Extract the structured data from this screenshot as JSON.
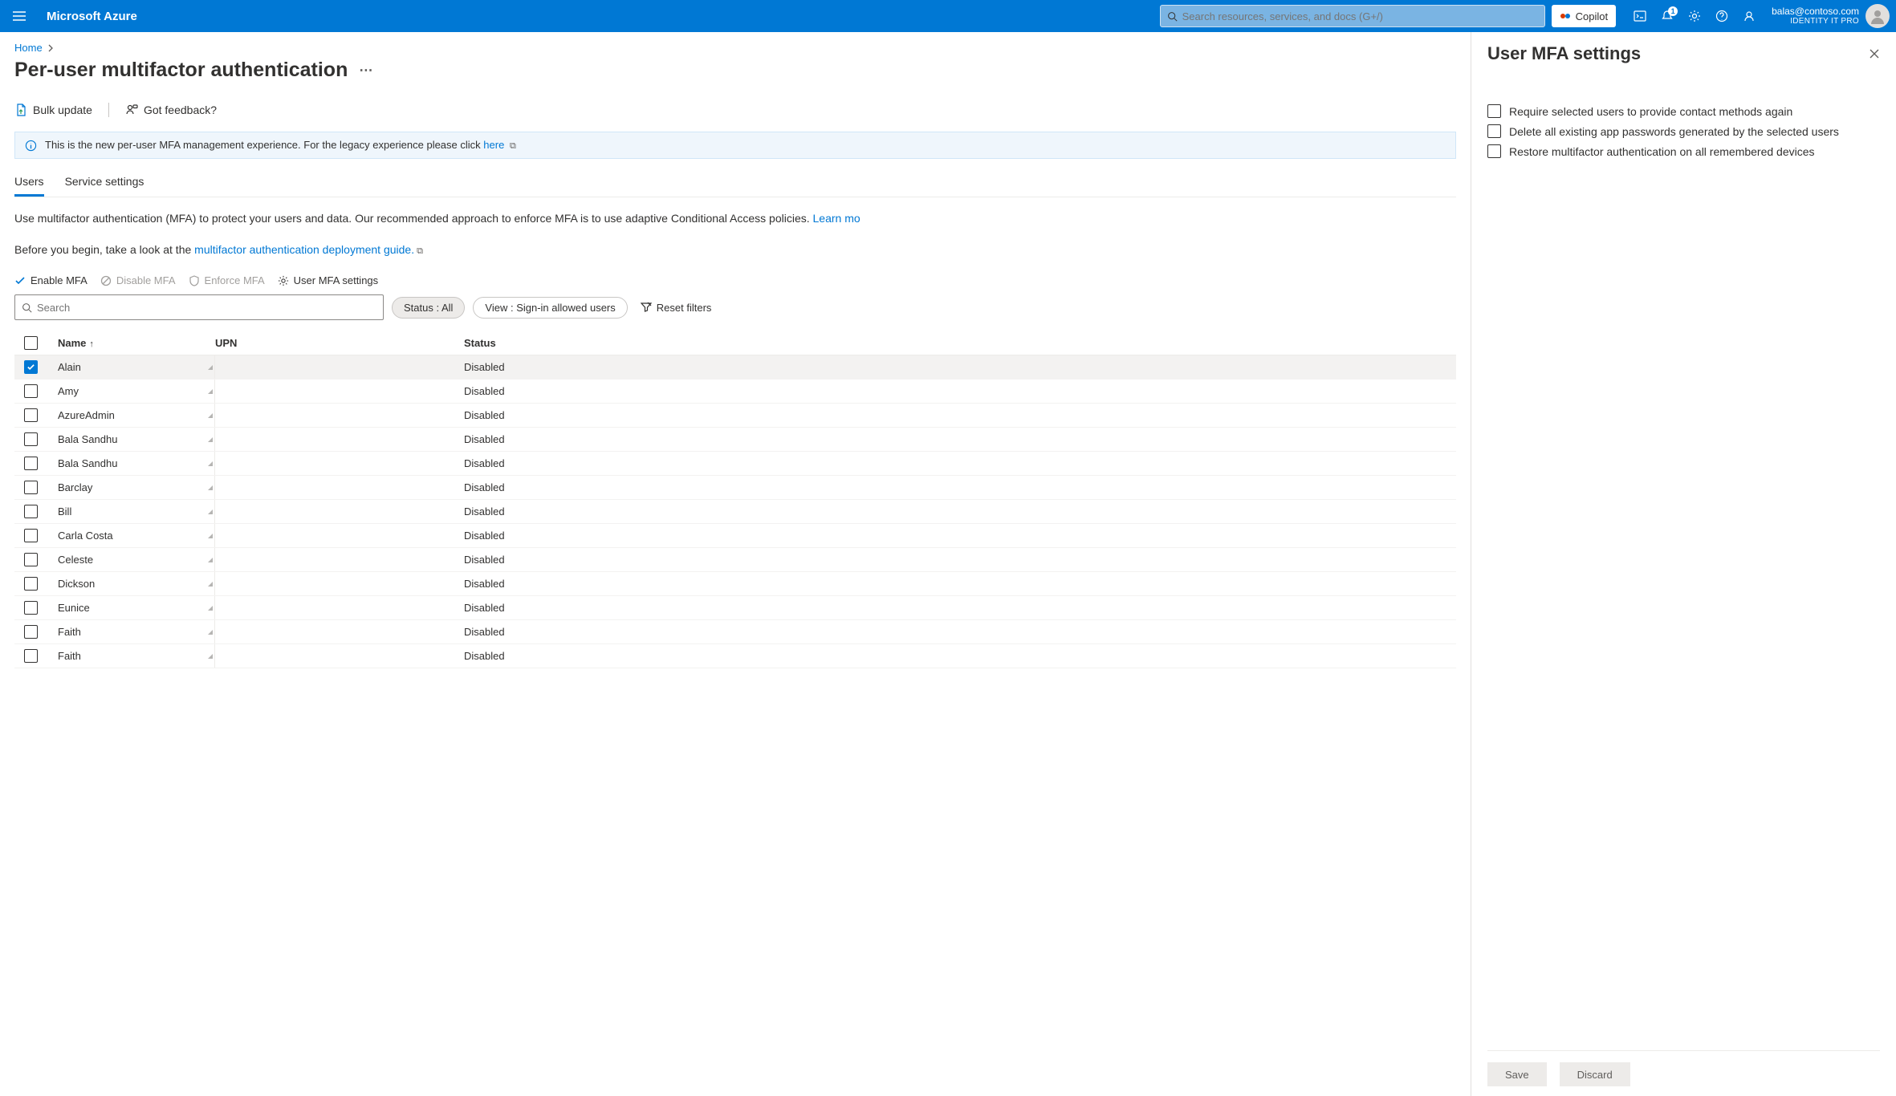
{
  "header": {
    "brand": "Microsoft Azure",
    "search_placeholder": "Search resources, services, and docs (G+/)",
    "copilot_label": "Copilot",
    "notif_badge": "1",
    "email": "balas@contoso.com",
    "role": "IDENTITY IT PRO"
  },
  "breadcrumb": {
    "items": [
      "Home"
    ]
  },
  "page": {
    "title": "Per-user multifactor authentication"
  },
  "toolbar": {
    "bulk_update": "Bulk update",
    "got_feedback": "Got feedback?"
  },
  "banner": {
    "text_prefix": "This is the new per-user MFA management experience. For the legacy experience please click ",
    "link": "here"
  },
  "tabs": {
    "users": "Users",
    "service": "Service settings"
  },
  "desc": {
    "line1_prefix": "Use multifactor authentication (MFA) to protect your users and data. Our recommended approach to enforce MFA is to use adaptive Conditional Access policies. ",
    "line1_link": "Learn mo",
    "line2_prefix": "Before you begin, take a look at the ",
    "line2_link": "multifactor authentication deployment guide."
  },
  "actions": {
    "enable": "Enable MFA",
    "disable": "Disable MFA",
    "enforce": "Enforce MFA",
    "settings": "User MFA settings"
  },
  "filters": {
    "search_placeholder": "Search",
    "status_pill": "Status : All",
    "view_pill": "View : Sign-in allowed users",
    "reset": "Reset filters"
  },
  "table": {
    "head": {
      "name": "Name",
      "upn": "UPN",
      "status": "Status"
    },
    "rows": [
      {
        "name": "Alain",
        "upn": "",
        "status": "Disabled",
        "checked": true
      },
      {
        "name": "Amy",
        "upn": "",
        "status": "Disabled",
        "checked": false
      },
      {
        "name": "AzureAdmin",
        "upn": "",
        "status": "Disabled",
        "checked": false
      },
      {
        "name": "Bala Sandhu",
        "upn": "",
        "status": "Disabled",
        "checked": false
      },
      {
        "name": "Bala Sandhu",
        "upn": "",
        "status": "Disabled",
        "checked": false
      },
      {
        "name": "Barclay",
        "upn": "",
        "status": "Disabled",
        "checked": false
      },
      {
        "name": "Bill",
        "upn": "",
        "status": "Disabled",
        "checked": false
      },
      {
        "name": "Carla Costa",
        "upn": "",
        "status": "Disabled",
        "checked": false
      },
      {
        "name": "Celeste",
        "upn": "",
        "status": "Disabled",
        "checked": false
      },
      {
        "name": "Dickson",
        "upn": "",
        "status": "Disabled",
        "checked": false
      },
      {
        "name": "Eunice",
        "upn": "",
        "status": "Disabled",
        "checked": false
      },
      {
        "name": "Faith",
        "upn": "",
        "status": "Disabled",
        "checked": false
      },
      {
        "name": "Faith",
        "upn": "",
        "status": "Disabled",
        "checked": false
      }
    ]
  },
  "panel": {
    "title": "User MFA settings",
    "opt1": "Require selected users to provide contact methods again",
    "opt2": "Delete all existing app passwords generated by the selected users",
    "opt3": "Restore multifactor authentication on all remembered devices",
    "save": "Save",
    "discard": "Discard"
  }
}
